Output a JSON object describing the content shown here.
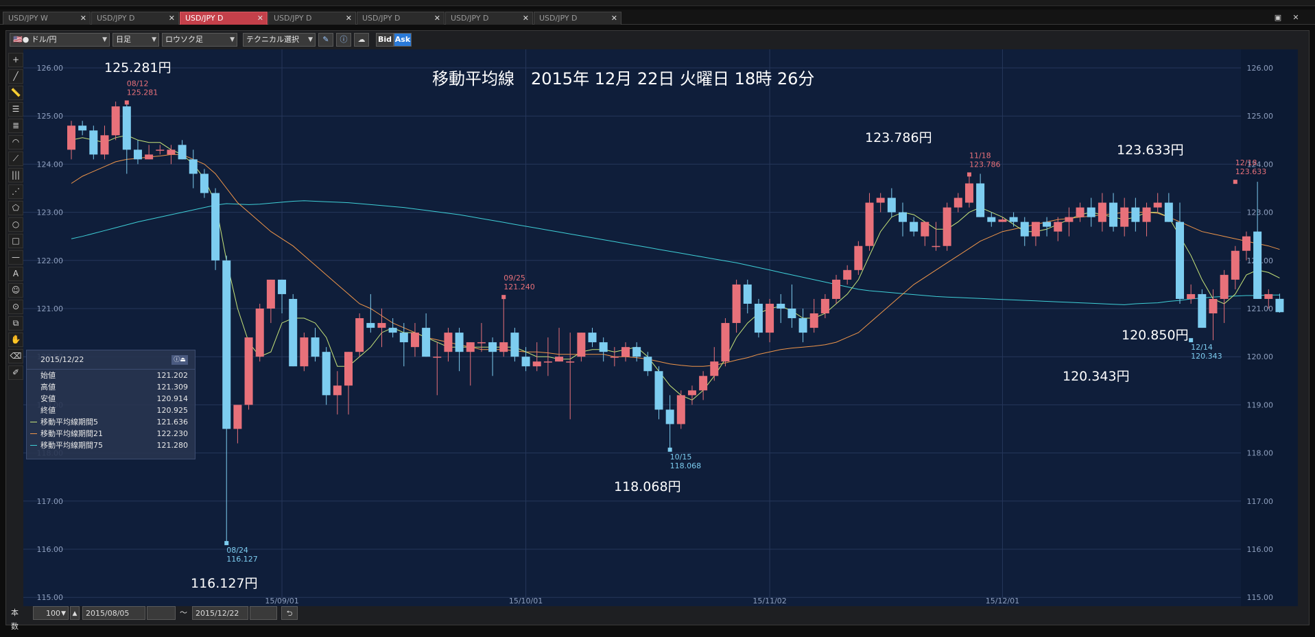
{
  "tabs": [
    {
      "label": "USD/JPY W",
      "active": false
    },
    {
      "label": "USD/JPY D",
      "active": false
    },
    {
      "label": "USD/JPY D",
      "active": true
    },
    {
      "label": "USD/JPY D",
      "active": false
    },
    {
      "label": "USD/JPY D",
      "active": false
    },
    {
      "label": "USD/JPY D",
      "active": false
    },
    {
      "label": "USD/JPY D",
      "active": false
    }
  ],
  "toolbar": {
    "pair": "ドル/円",
    "period": "日足",
    "chart_type": "ロウソク足",
    "technical": "テクニカル選択",
    "bid_label": "Bid",
    "ask_label": "Ask"
  },
  "overlay_title": "移動平均線　2015年 12月 22日 火曜日 18時 26分",
  "big_labels": {
    "high1": "125.281円",
    "low1": "116.127円",
    "low2": "118.068円",
    "high2": "123.786円",
    "high3": "123.633円",
    "low3": "120.343円",
    "last": "120.850円"
  },
  "small_labels": {
    "h1_date": "08/12",
    "h1_val": "125.281",
    "l1_date": "08/24",
    "l1_val": "116.127",
    "m1_date": "09/25",
    "m1_val": "121.240",
    "l2_date": "10/15",
    "l2_val": "118.068",
    "h2_date": "11/18",
    "h2_val": "123.786",
    "h3_date": "12/18",
    "h3_val": "123.633",
    "l3_date": "12/14",
    "l3_val": "120.343"
  },
  "info_panel": {
    "date": "2015/12/22",
    "rows": [
      {
        "label": "始値",
        "value": "121.202"
      },
      {
        "label": "高値",
        "value": "121.309"
      },
      {
        "label": "安値",
        "value": "120.914"
      },
      {
        "label": "終値",
        "value": "120.925"
      },
      {
        "label": "移動平均線期間5",
        "value": "121.636",
        "color": "#c8e67a"
      },
      {
        "label": "移動平均線期間21",
        "value": "122.230",
        "color": "#f0964a"
      },
      {
        "label": "移動平均線期間75",
        "value": "121.280",
        "color": "#3fd0d8"
      }
    ]
  },
  "bottom": {
    "count_label": "本数",
    "count_value": "100",
    "from_date": "2015/08/05",
    "tilde": "～",
    "to_date": "2015/12/22"
  },
  "colors": {
    "up": "#e8717a",
    "down": "#7dcdf0",
    "ma5": "#c8e67a",
    "ma21": "#f0964a",
    "ma75": "#3fd0d8",
    "bg": "#0f1e3a",
    "grid": "#26375a"
  },
  "chart_data": {
    "type": "candlestick",
    "ylim": [
      115,
      126
    ],
    "y_ticks": [
      "126.00",
      "125.00",
      "124.00",
      "123.00",
      "122.00",
      "121.00",
      "120.00",
      "119.00",
      "118.00",
      "117.00",
      "116.00",
      "115.00"
    ],
    "x_labels": [
      {
        "label": "15/09/01",
        "index": 19
      },
      {
        "label": "15/10/01",
        "index": 41
      },
      {
        "label": "15/11/02",
        "index": 63
      },
      {
        "label": "15/12/01",
        "index": 84
      }
    ],
    "candles": [
      [
        124.3,
        124.9,
        124.1,
        124.8
      ],
      [
        124.8,
        124.9,
        124.6,
        124.7
      ],
      [
        124.7,
        124.8,
        124.1,
        124.2
      ],
      [
        124.2,
        124.8,
        124.1,
        124.6
      ],
      [
        124.6,
        125.3,
        124.5,
        125.2
      ],
      [
        125.2,
        125.281,
        123.8,
        124.3
      ],
      [
        124.3,
        124.5,
        124.0,
        124.1
      ],
      [
        124.1,
        124.4,
        124.1,
        124.2
      ],
      [
        124.3,
        124.4,
        124.2,
        124.3
      ],
      [
        124.2,
        124.4,
        124.0,
        124.3
      ],
      [
        124.4,
        124.5,
        124.1,
        124.1
      ],
      [
        124.1,
        124.3,
        123.5,
        123.8
      ],
      [
        123.8,
        123.9,
        123.3,
        123.4
      ],
      [
        123.4,
        123.5,
        121.8,
        122.0
      ],
      [
        122.0,
        122.1,
        116.127,
        118.5
      ],
      [
        118.5,
        118.9,
        118.2,
        119.0
      ],
      [
        119.0,
        120.4,
        118.9,
        120.4
      ],
      [
        120.0,
        121.1,
        119.9,
        121.0
      ],
      [
        121.0,
        121.6,
        120.7,
        121.6
      ],
      [
        121.6,
        121.6,
        120.9,
        121.3
      ],
      [
        121.2,
        121.3,
        119.8,
        119.8
      ],
      [
        119.8,
        120.5,
        119.7,
        120.4
      ],
      [
        120.4,
        120.6,
        119.9,
        120.0
      ],
      [
        120.1,
        120.2,
        119.0,
        119.2
      ],
      [
        119.2,
        119.7,
        118.8,
        119.4
      ],
      [
        119.4,
        120.1,
        118.8,
        120.1
      ],
      [
        120.1,
        120.9,
        120.0,
        120.8
      ],
      [
        120.7,
        121.3,
        120.5,
        120.6
      ],
      [
        120.6,
        121.0,
        120.2,
        120.7
      ],
      [
        120.6,
        120.8,
        120.4,
        120.5
      ],
      [
        120.5,
        120.7,
        119.8,
        120.3
      ],
      [
        120.2,
        120.7,
        120.0,
        120.5
      ],
      [
        120.6,
        120.9,
        120.0,
        120.0
      ],
      [
        120.0,
        120.3,
        119.2,
        120.0
      ],
      [
        120.1,
        120.6,
        119.9,
        120.5
      ],
      [
        120.5,
        120.6,
        119.7,
        120.1
      ],
      [
        120.1,
        120.3,
        119.4,
        120.3
      ],
      [
        120.3,
        120.7,
        120.1,
        120.3
      ],
      [
        120.3,
        120.4,
        119.6,
        120.1
      ],
      [
        120.1,
        121.24,
        120.0,
        120.3
      ],
      [
        120.5,
        120.6,
        119.9,
        120.0
      ],
      [
        120.0,
        120.2,
        119.7,
        119.8
      ],
      [
        119.8,
        120.3,
        119.7,
        119.9
      ],
      [
        119.9,
        120.4,
        119.6,
        119.9
      ],
      [
        119.9,
        120.6,
        119.9,
        120.0
      ],
      [
        119.9,
        120.5,
        118.7,
        119.9
      ],
      [
        120.0,
        120.5,
        119.9,
        120.5
      ],
      [
        120.5,
        120.6,
        120.2,
        120.3
      ],
      [
        120.3,
        120.4,
        119.9,
        120.1
      ],
      [
        120.0,
        120.2,
        119.8,
        120.0
      ],
      [
        120.0,
        120.3,
        119.9,
        120.2
      ],
      [
        120.2,
        120.3,
        119.9,
        120.0
      ],
      [
        120.0,
        120.1,
        119.6,
        119.7
      ],
      [
        119.7,
        119.8,
        118.7,
        118.9
      ],
      [
        118.9,
        119.2,
        118.068,
        118.6
      ],
      [
        118.6,
        119.3,
        118.5,
        119.2
      ],
      [
        119.2,
        119.4,
        119.0,
        119.3
      ],
      [
        119.3,
        119.7,
        119.1,
        119.6
      ],
      [
        119.6,
        120.2,
        119.5,
        119.9
      ],
      [
        119.9,
        120.8,
        119.8,
        120.7
      ],
      [
        120.7,
        121.6,
        120.5,
        121.5
      ],
      [
        121.5,
        121.6,
        120.9,
        121.1
      ],
      [
        121.1,
        121.2,
        120.4,
        120.5
      ],
      [
        120.5,
        121.2,
        120.3,
        121.1
      ],
      [
        121.1,
        121.3,
        120.7,
        121.0
      ],
      [
        121.0,
        121.5,
        120.6,
        120.8
      ],
      [
        120.8,
        121.0,
        120.3,
        120.5
      ],
      [
        120.6,
        121.2,
        120.5,
        120.9
      ],
      [
        120.9,
        121.3,
        120.8,
        121.2
      ],
      [
        121.2,
        121.7,
        121.1,
        121.6
      ],
      [
        121.6,
        121.9,
        121.5,
        121.8
      ],
      [
        121.8,
        122.4,
        121.7,
        122.3
      ],
      [
        122.3,
        123.4,
        122.2,
        123.2
      ],
      [
        123.2,
        123.4,
        123.0,
        123.3
      ],
      [
        123.3,
        123.5,
        122.9,
        123.0
      ],
      [
        123.0,
        123.2,
        122.5,
        122.8
      ],
      [
        122.8,
        122.9,
        122.5,
        122.6
      ],
      [
        122.5,
        122.8,
        122.3,
        122.8
      ],
      [
        122.3,
        122.8,
        122.2,
        122.3
      ],
      [
        122.3,
        123.2,
        122.2,
        123.1
      ],
      [
        123.1,
        123.4,
        123.0,
        123.3
      ],
      [
        123.2,
        123.786,
        123.1,
        123.6
      ],
      [
        123.6,
        123.8,
        122.9,
        122.9
      ],
      [
        122.9,
        123.0,
        122.7,
        122.8
      ],
      [
        122.8,
        122.9,
        122.8,
        122.85
      ],
      [
        122.9,
        123.0,
        122.7,
        122.8
      ],
      [
        122.8,
        122.9,
        122.3,
        122.5
      ],
      [
        122.5,
        122.8,
        122.3,
        122.8
      ],
      [
        122.8,
        122.9,
        122.5,
        122.7
      ],
      [
        122.6,
        122.9,
        122.4,
        122.8
      ],
      [
        122.8,
        123.1,
        122.5,
        122.9
      ],
      [
        122.9,
        123.2,
        122.8,
        123.1
      ],
      [
        123.1,
        123.3,
        122.7,
        122.9
      ],
      [
        122.8,
        123.4,
        122.6,
        123.2
      ],
      [
        123.2,
        123.4,
        122.6,
        122.7
      ],
      [
        122.7,
        123.3,
        122.5,
        123.1
      ],
      [
        123.1,
        123.3,
        122.6,
        122.8
      ],
      [
        122.8,
        123.2,
        122.5,
        123.1
      ],
      [
        123.1,
        123.4,
        123.0,
        123.2
      ],
      [
        123.2,
        123.4,
        122.8,
        122.8
      ],
      [
        122.8,
        123.2,
        121.1,
        121.2
      ],
      [
        121.2,
        121.5,
        121.1,
        121.3
      ],
      [
        121.3,
        121.4,
        120.6,
        120.6
      ],
      [
        120.9,
        121.4,
        120.343,
        121.2
      ],
      [
        121.2,
        121.8,
        120.7,
        121.7
      ],
      [
        121.6,
        122.3,
        121.4,
        122.2
      ],
      [
        122.2,
        122.6,
        122.0,
        122.5
      ],
      [
        122.6,
        123.633,
        121.2,
        121.2
      ],
      [
        121.2,
        121.4,
        121.0,
        121.3
      ],
      [
        121.202,
        121.309,
        120.914,
        120.925
      ]
    ],
    "ma5": [
      124.5,
      124.55,
      124.5,
      124.45,
      124.55,
      124.6,
      124.5,
      124.45,
      124.45,
      124.3,
      124.2,
      124.0,
      123.7,
      123.2,
      122.0,
      121.0,
      120.3,
      120.0,
      120.1,
      120.7,
      120.8,
      120.8,
      120.7,
      120.4,
      119.8,
      119.8,
      120.0,
      120.2,
      120.5,
      120.6,
      120.5,
      120.5,
      120.4,
      120.3,
      120.2,
      120.2,
      120.2,
      120.2,
      120.2,
      120.2,
      120.2,
      120.1,
      120.0,
      120.0,
      119.95,
      119.95,
      120.1,
      120.15,
      120.15,
      120.1,
      120.15,
      120.2,
      120.0,
      119.7,
      119.4,
      119.2,
      119.1,
      119.3,
      119.6,
      119.95,
      120.4,
      120.7,
      120.9,
      121.0,
      121.05,
      120.95,
      120.8,
      120.8,
      120.9,
      121.1,
      121.3,
      121.6,
      122.1,
      122.6,
      122.9,
      123.0,
      122.95,
      122.8,
      122.65,
      122.65,
      122.8,
      123.0,
      123.1,
      123.0,
      122.9,
      122.75,
      122.6,
      122.6,
      122.65,
      122.75,
      122.85,
      122.95,
      123.0,
      122.95,
      122.9,
      122.85,
      122.9,
      123.0,
      123.0,
      122.9,
      122.5,
      122.1,
      121.6,
      121.2,
      121.1,
      121.3,
      121.7,
      121.8,
      121.75,
      121.636
    ],
    "ma21": [
      123.6,
      123.75,
      123.85,
      123.95,
      124.05,
      124.1,
      124.12,
      124.15,
      124.17,
      124.2,
      124.2,
      124.1,
      124.0,
      123.8,
      123.5,
      123.2,
      123.0,
      122.8,
      122.6,
      122.45,
      122.3,
      122.1,
      121.9,
      121.7,
      121.5,
      121.3,
      121.1,
      121.0,
      120.85,
      120.7,
      120.6,
      120.5,
      120.4,
      120.35,
      120.3,
      120.25,
      120.2,
      120.15,
      120.15,
      120.15,
      120.12,
      120.1,
      120.1,
      120.08,
      120.05,
      120.05,
      120.05,
      120.05,
      120.05,
      120.0,
      120.0,
      119.98,
      119.95,
      119.9,
      119.85,
      119.82,
      119.8,
      119.8,
      119.82,
      119.87,
      119.93,
      119.98,
      120.05,
      120.1,
      120.15,
      120.18,
      120.2,
      120.22,
      120.25,
      120.3,
      120.4,
      120.5,
      120.7,
      120.9,
      121.1,
      121.3,
      121.5,
      121.65,
      121.8,
      121.95,
      122.1,
      122.25,
      122.4,
      122.5,
      122.6,
      122.65,
      122.7,
      122.75,
      122.8,
      122.85,
      122.87,
      122.9,
      122.92,
      122.95,
      122.97,
      123.0,
      123.0,
      123.0,
      122.98,
      122.9,
      122.8,
      122.7,
      122.6,
      122.55,
      122.5,
      122.45,
      122.4,
      122.35,
      122.3,
      122.23
    ],
    "ma75": [
      122.45,
      122.5,
      122.56,
      122.62,
      122.68,
      122.74,
      122.8,
      122.85,
      122.9,
      122.95,
      123.0,
      123.05,
      123.1,
      123.15,
      123.18,
      123.17,
      123.16,
      123.17,
      123.19,
      123.21,
      123.23,
      123.24,
      123.23,
      123.22,
      123.21,
      123.2,
      123.18,
      123.16,
      123.14,
      123.12,
      123.1,
      123.07,
      123.04,
      123.01,
      122.98,
      122.95,
      122.91,
      122.87,
      122.83,
      122.79,
      122.75,
      122.71,
      122.67,
      122.63,
      122.59,
      122.55,
      122.51,
      122.47,
      122.43,
      122.39,
      122.35,
      122.31,
      122.27,
      122.23,
      122.19,
      122.15,
      122.11,
      122.07,
      122.03,
      121.99,
      121.95,
      121.9,
      121.85,
      121.8,
      121.75,
      121.7,
      121.65,
      121.6,
      121.55,
      121.5,
      121.45,
      121.4,
      121.37,
      121.35,
      121.33,
      121.31,
      121.29,
      121.27,
      121.25,
      121.24,
      121.23,
      121.22,
      121.21,
      121.2,
      121.19,
      121.18,
      121.17,
      121.16,
      121.15,
      121.14,
      121.13,
      121.12,
      121.11,
      121.1,
      121.09,
      121.08,
      121.1,
      121.11,
      121.12,
      121.15,
      121.17,
      121.2,
      121.22,
      121.24,
      121.25,
      121.26,
      121.27,
      121.27,
      121.28,
      121.28
    ]
  }
}
